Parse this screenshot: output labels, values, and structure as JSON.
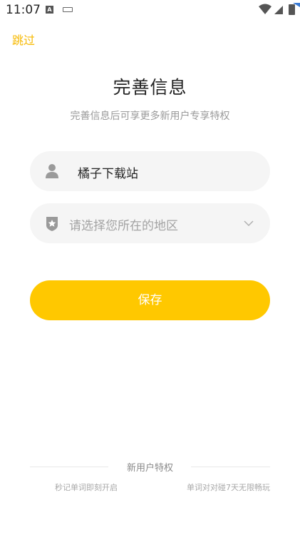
{
  "status_bar": {
    "time": "11:07",
    "left_icons": [
      "a-icon",
      "keyboard-icon"
    ],
    "right_icons": [
      "wifi-icon",
      "signal-icon",
      "battery-icon"
    ]
  },
  "header": {
    "skip_label": "跳过"
  },
  "main": {
    "title": "完善信息",
    "subtitle": "完善信息后可享更多新用户专享特权",
    "name_field": {
      "value": "橘子下载站",
      "icon": "user-icon"
    },
    "region_field": {
      "placeholder": "请选择您所在的地区",
      "icon": "shield-star-icon",
      "chevron": "chevron-down-icon"
    },
    "save_label": "保存"
  },
  "footer": {
    "title": "新用户特权",
    "perks": [
      "秒记单词即刻开启",
      "单词对对碰7天无限畅玩"
    ]
  },
  "colors": {
    "accent": "#ffc800",
    "skip": "#f7b900",
    "field_bg": "#f5f5f5"
  }
}
